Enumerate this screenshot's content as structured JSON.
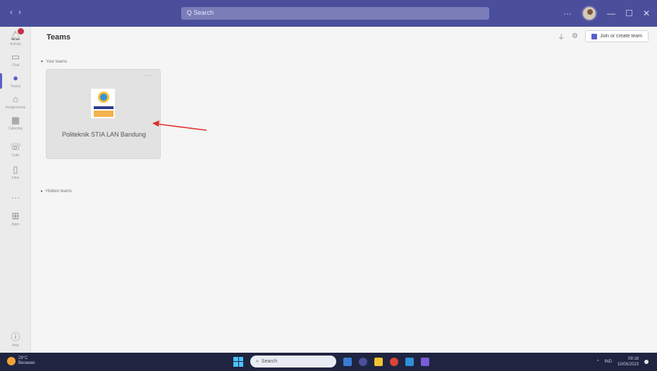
{
  "window": {
    "title": "Teams"
  },
  "titlebar": {
    "back_glyph": "‹",
    "forward_glyph": "›",
    "search_placeholder": "Q Search",
    "more_glyph": "···",
    "minimize_glyph": "—",
    "maximize_glyph": "☐",
    "close_glyph": "✕"
  },
  "rail": {
    "items": [
      {
        "name": "activity",
        "icon": "bell-icon",
        "glyph": "🔔︎",
        "label": "Activity",
        "badge": true
      },
      {
        "name": "chat",
        "icon": "chat-icon",
        "glyph": "▭",
        "label": "Chat"
      },
      {
        "name": "teams",
        "icon": "teams-icon",
        "glyph": "●",
        "label": "Teams",
        "active": true
      },
      {
        "name": "assignments",
        "icon": "assignments-icon",
        "glyph": "⌂",
        "label": "Assignments"
      },
      {
        "name": "calendar",
        "icon": "calendar-icon",
        "glyph": "▦",
        "label": "Calendar"
      },
      {
        "name": "calls",
        "icon": "phone-icon",
        "glyph": "☏",
        "label": "Calls"
      },
      {
        "name": "files",
        "icon": "file-icon",
        "glyph": "▯",
        "label": "Files"
      },
      {
        "name": "more",
        "icon": "more-icon",
        "glyph": "···",
        "label": ""
      },
      {
        "name": "apps",
        "icon": "apps-icon",
        "glyph": "⊞",
        "label": "Apps"
      }
    ],
    "help": {
      "icon": "help-icon",
      "glyph": "ⓘ",
      "label": "Help"
    }
  },
  "main": {
    "page_title": "Teams",
    "filter_glyph": "⏚",
    "settings_glyph": "⚙",
    "join_button_label": "Join or create team",
    "your_teams_label": "Your teams",
    "hidden_teams_label": "Hidden teams",
    "team_card": {
      "name": "Politeknik STIA LAN Bandung",
      "more_glyph": "···"
    }
  },
  "taskbar": {
    "weather_temp": "29°C",
    "weather_desc": "Berawan",
    "search_placeholder": "Search",
    "tray_lang": "IND",
    "time": "09:18",
    "date": "10/05/2023",
    "apps": [
      "#3a7bd5",
      "#4b4e9b",
      "#f2c230",
      "#db4437",
      "#2f8fd8",
      "#7a5cd6"
    ]
  }
}
